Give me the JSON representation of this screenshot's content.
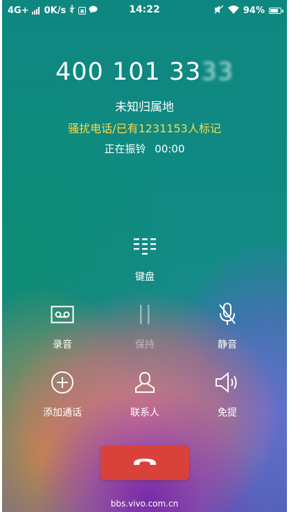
{
  "status_bar": {
    "network": "4G+",
    "speed": "0K/s",
    "time": "14:22",
    "battery": "94%",
    "battery_level": 0.94
  },
  "call": {
    "number_visible": "400 101 33",
    "number_obscured": "33",
    "location": "未知归属地",
    "spam_label": "骚扰电话/已有1231153人标记",
    "status": "正在振铃",
    "duration": "00:00"
  },
  "controls": {
    "keypad": "键盘",
    "record": "录音",
    "hold": "保持",
    "mute": "静音",
    "add_call": "添加通话",
    "contacts": "联系人",
    "speaker": "免提"
  },
  "watermark": "bbs.vivo.com.cn",
  "colors": {
    "spam_text": "#ffd84a",
    "end_call": "#d9423b"
  }
}
